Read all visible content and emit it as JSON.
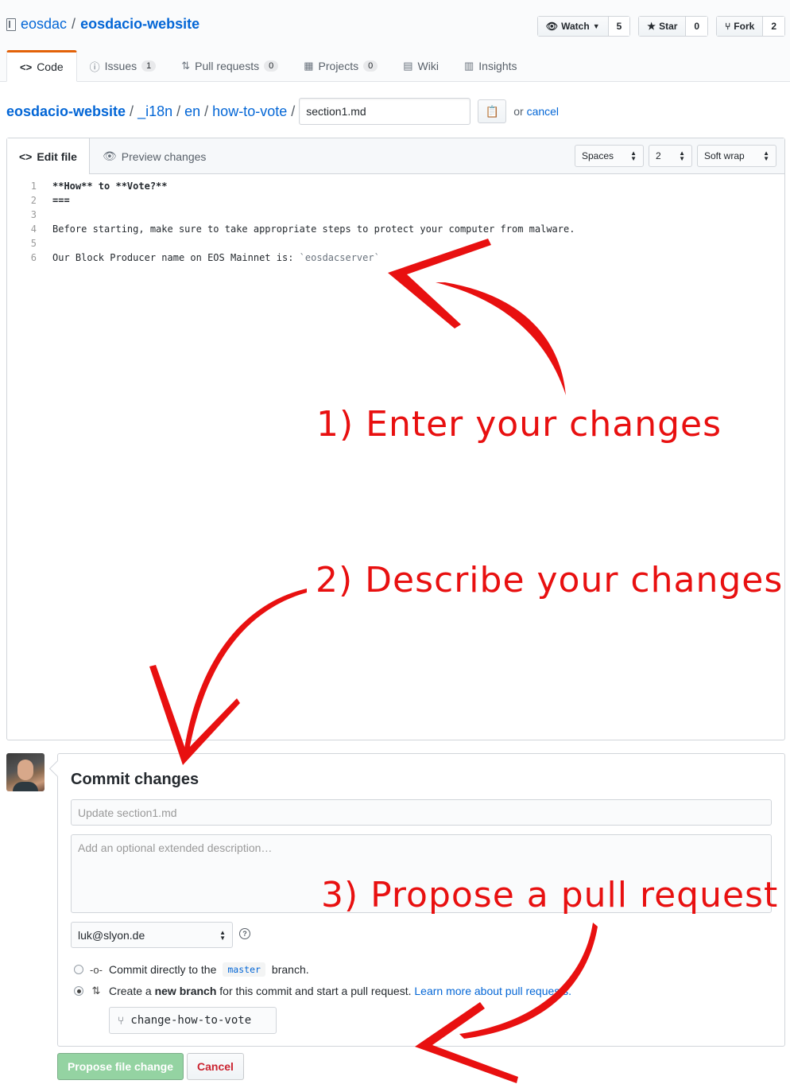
{
  "repo": {
    "owner": "eosdac",
    "separator": "/",
    "name": "eosdacio-website"
  },
  "actions": {
    "watch": {
      "label": "Watch",
      "count": "5"
    },
    "star": {
      "label": "Star",
      "count": "0"
    },
    "fork": {
      "label": "Fork",
      "count": "2"
    }
  },
  "tabs": [
    {
      "label": "Code"
    },
    {
      "label": "Issues",
      "count": "1"
    },
    {
      "label": "Pull requests",
      "count": "0"
    },
    {
      "label": "Projects",
      "count": "0"
    },
    {
      "label": "Wiki"
    },
    {
      "label": "Insights"
    }
  ],
  "breadcrumb": {
    "root": "eosdacio-website",
    "parts": [
      "_i18n",
      "en",
      "how-to-vote"
    ],
    "sep": "/",
    "filename": "section1.md",
    "or": "or",
    "cancel": "cancel"
  },
  "editor": {
    "tab_edit": "Edit file",
    "tab_preview": "Preview changes",
    "indent_mode": "Spaces",
    "indent_size": "2",
    "wrap_mode": "Soft wrap",
    "lines": [
      {
        "n": "1",
        "text": "**How** to **Vote?**"
      },
      {
        "n": "2",
        "text": "==="
      },
      {
        "n": "3",
        "text": ""
      },
      {
        "n": "4",
        "text": "Before starting, make sure to take appropriate steps to protect your computer from malware."
      },
      {
        "n": "5",
        "text": ""
      },
      {
        "n": "6",
        "text_prefix": "Our Block Producer name on EOS Mainnet is: ",
        "text_code": "`eosdacserver`"
      }
    ]
  },
  "commit": {
    "title": "Commit changes",
    "summary_placeholder": "Update section1.md",
    "description_placeholder": "Add an optional extended description…",
    "email": "luk@slyon.de",
    "option_direct": {
      "pre": "Commit directly to the",
      "branch": "master",
      "post": "branch."
    },
    "option_branch": {
      "pre": "Create a",
      "bold": "new branch",
      "post": "for this commit and start a pull request.",
      "link": "Learn more about pull requests."
    },
    "branch_name": "change-how-to-vote",
    "propose_label": "Propose file change",
    "cancel_label": "Cancel"
  },
  "annotations": {
    "step1": "1) Enter your changes",
    "step2": "2) Describe your changes",
    "step3": "3) Propose a pull request",
    "color": "#e81010"
  },
  "icons": {
    "repo": "repo-book-icon",
    "watch": "eye-icon",
    "star": "star-icon",
    "fork": "fork-icon",
    "code": "code-icon",
    "issues": "issue-icon",
    "pr": "pull-request-icon",
    "projects": "project-icon",
    "wiki": "book-icon",
    "insights": "graph-icon",
    "clipboard": "clipboard-icon",
    "preview": "eye-icon",
    "help": "question-icon",
    "commit": "git-commit-icon",
    "pr_branch": "git-pull-request-icon",
    "branch": "git-branch-icon"
  }
}
